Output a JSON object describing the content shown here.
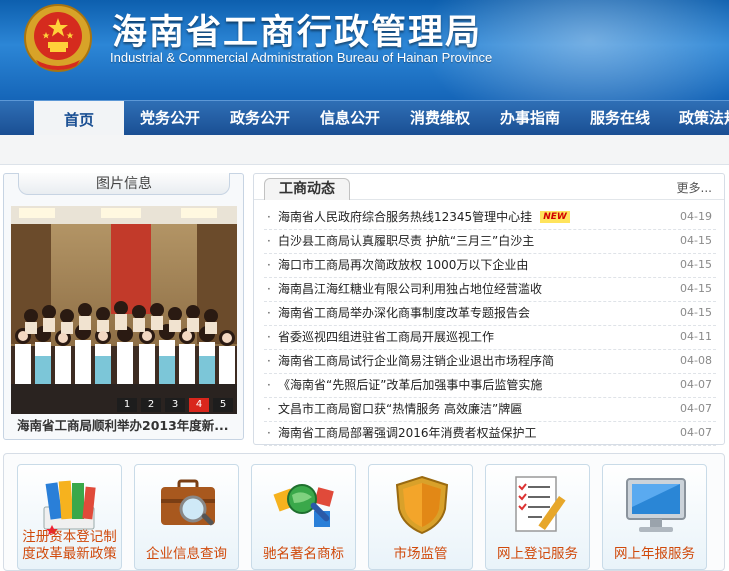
{
  "header": {
    "title": "海南省工商行政管理局",
    "subtitle": "Industrial & Commercial Administration Bureau of Hainan Province"
  },
  "nav": {
    "items": [
      "首页",
      "党务公开",
      "政务公开",
      "信息公开",
      "消费维权",
      "办事指南",
      "服务在线",
      "政策法规"
    ],
    "active": 0
  },
  "photo": {
    "tab_label": "图片信息",
    "caption": "海南省工商局顺利举办2013年度新...",
    "slides": [
      "1",
      "2",
      "3",
      "4",
      "5"
    ],
    "active_slide": 3
  },
  "news": {
    "tab_label": "工商动态",
    "more_label": "更多...",
    "badge_new": "NEW",
    "items": [
      {
        "title": "海南省人民政府综合服务热线12345管理中心挂",
        "date": "04-19",
        "new": true
      },
      {
        "title": "白沙县工商局认真履职尽责 护航“三月三”白沙主",
        "date": "04-15"
      },
      {
        "title": "海口市工商局再次简政放权 1000万以下企业由",
        "date": "04-15"
      },
      {
        "title": "海南昌江海红糖业有限公司利用独占地位经营滥收",
        "date": "04-15"
      },
      {
        "title": "海南省工商局举办深化商事制度改革专题报告会",
        "date": "04-15"
      },
      {
        "title": "省委巡视四组进驻省工商局开展巡视工作",
        "date": "04-11"
      },
      {
        "title": "海南省工商局试行企业简易注销企业退出市场程序简",
        "date": "04-08"
      },
      {
        "title": "《海南省“先照后证”改革后加强事中事后监管实施",
        "date": "04-07"
      },
      {
        "title": "文昌市工商局窗口获“热情服务 高效廉洁”牌匾",
        "date": "04-07"
      },
      {
        "title": "海南省工商局部署强调2016年消费者权益保护工",
        "date": "04-07"
      }
    ]
  },
  "services": [
    {
      "label": "注册资本登记制度改革最新政策",
      "icon": "books-icon"
    },
    {
      "label": "企业信息查询",
      "icon": "briefcase-magnifier-icon"
    },
    {
      "label": "驰名著名商标",
      "icon": "trademark-globe-icon"
    },
    {
      "label": "市场监管",
      "icon": "shield-icon"
    },
    {
      "label": "网上登记服务",
      "icon": "checklist-pen-icon"
    },
    {
      "label": "网上年报服务",
      "icon": "monitor-icon"
    }
  ],
  "colors": {
    "banner": "#1565b8",
    "nav": "#1a4f93",
    "service_label": "#d04a0c",
    "slide_active": "#d9261c"
  }
}
